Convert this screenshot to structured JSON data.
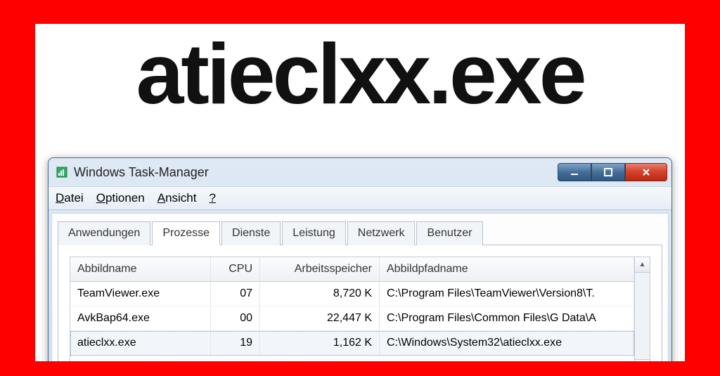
{
  "headline": "atieclxx.exe",
  "window": {
    "title": "Windows Task-Manager",
    "menu": {
      "file": "Datei",
      "options": "Optionen",
      "view": "Ansicht",
      "help": "?"
    },
    "tabs": {
      "applications": "Anwendungen",
      "processes": "Prozesse",
      "services": "Dienste",
      "performance": "Leistung",
      "networking": "Netzwerk",
      "users": "Benutzer",
      "active": "processes"
    },
    "columns": {
      "image_name": "Abbildname",
      "cpu": "CPU",
      "memory": "Arbeitsspeicher",
      "path": "Abbildpfadname"
    },
    "rows": [
      {
        "name": "TeamViewer.exe",
        "cpu": "07",
        "mem": "8,720 K",
        "path": "C:\\Program Files\\TeamViewer\\Version8\\T.",
        "selected": false
      },
      {
        "name": "AvkBap64.exe",
        "cpu": "00",
        "mem": "22,447 K",
        "path": "C:\\Program Files\\Common Files\\G Data\\A",
        "selected": false
      },
      {
        "name": "atieclxx.exe",
        "cpu": "19",
        "mem": "1,162 K",
        "path": "C:\\Windows\\System32\\atieclxx.exe",
        "selected": true
      }
    ]
  },
  "icons": {
    "task_manager": "taskmgr-icon",
    "minimize": "minimize-icon",
    "maximize": "maximize-icon",
    "close": "close-icon",
    "scroll_up": "▲",
    "scroll_down": "▼"
  }
}
